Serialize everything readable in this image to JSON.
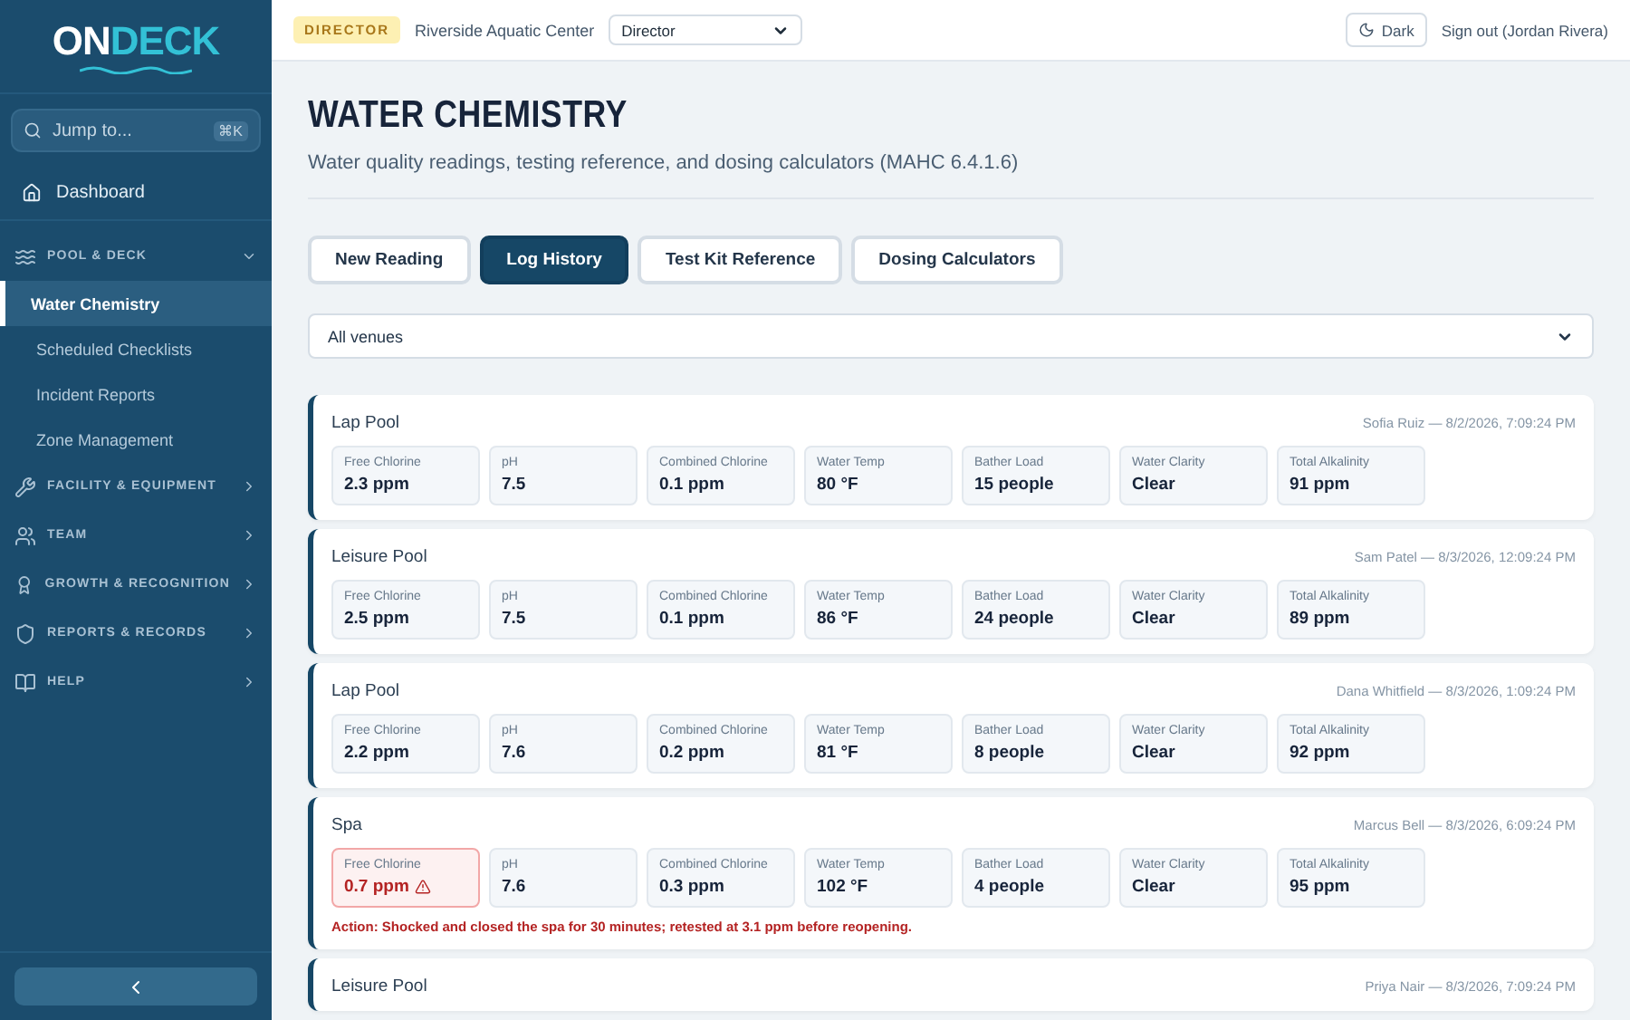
{
  "sidebar": {
    "logo": {
      "part_1": "ON",
      "part_2": "DECK"
    },
    "search": {
      "placeholder": "Jump to...",
      "shortcut": "⌘K"
    },
    "dashboard": {
      "label": "Dashboard",
      "kind": "home"
    },
    "sections": [
      {
        "label": "POOL & DECK",
        "kind": "waves",
        "expanded": true,
        "children": [
          {
            "label": "Water Chemistry",
            "selected": true
          },
          {
            "label": "Scheduled Checklists",
            "selected": false
          },
          {
            "label": "Incident Reports",
            "selected": false
          },
          {
            "label": "Zone Management",
            "selected": false
          }
        ]
      },
      {
        "label": "FACILITY & EQUIPMENT",
        "kind": "wrench",
        "expanded": false
      },
      {
        "label": "TEAM",
        "kind": "team",
        "expanded": false
      },
      {
        "label": "GROWTH & RECOGNITION",
        "kind": "award",
        "expanded": false
      },
      {
        "label": "REPORTS & RECORDS",
        "kind": "shield",
        "expanded": false
      },
      {
        "label": "HELP",
        "kind": "book",
        "expanded": false
      }
    ]
  },
  "topbar": {
    "role_badge": "DIRECTOR",
    "facility": "Riverside Aquatic Center",
    "role_select": "Director",
    "theme_button": "Dark",
    "sign_out": "Sign out (Jordan Rivera)"
  },
  "page": {
    "title": "WATER CHEMISTRY",
    "subtitle": "Water quality readings, testing reference, and dosing calculators (MAHC 6.4.1.6)"
  },
  "tabs": [
    {
      "label": "New Reading",
      "selected": false
    },
    {
      "label": "Log History",
      "selected": true
    },
    {
      "label": "Test Kit Reference",
      "selected": false
    },
    {
      "label": "Dosing Calculators",
      "selected": false
    }
  ],
  "venue_filter": "All venues",
  "readings": [
    {
      "venue": "Lap Pool",
      "meta": "Sofia Ruiz — 8/2/2026, 7:09:24 PM",
      "metrics": [
        {
          "label": "Free Chlorine",
          "value": "2.3 ppm",
          "alert": false
        },
        {
          "label": "pH",
          "value": "7.5",
          "alert": false
        },
        {
          "label": "Combined Chlorine",
          "value": "0.1 ppm",
          "alert": false
        },
        {
          "label": "Water Temp",
          "value": "80 °F",
          "alert": false
        },
        {
          "label": "Bather Load",
          "value": "15 people",
          "alert": false
        },
        {
          "label": "Water Clarity",
          "value": "Clear",
          "alert": false
        },
        {
          "label": "Total Alkalinity",
          "value": "91 ppm",
          "alert": false
        }
      ]
    },
    {
      "venue": "Leisure Pool",
      "meta": "Sam Patel — 8/3/2026, 12:09:24 PM",
      "metrics": [
        {
          "label": "Free Chlorine",
          "value": "2.5 ppm",
          "alert": false
        },
        {
          "label": "pH",
          "value": "7.5",
          "alert": false
        },
        {
          "label": "Combined Chlorine",
          "value": "0.1 ppm",
          "alert": false
        },
        {
          "label": "Water Temp",
          "value": "86 °F",
          "alert": false
        },
        {
          "label": "Bather Load",
          "value": "24 people",
          "alert": false
        },
        {
          "label": "Water Clarity",
          "value": "Clear",
          "alert": false
        },
        {
          "label": "Total Alkalinity",
          "value": "89 ppm",
          "alert": false
        }
      ]
    },
    {
      "venue": "Lap Pool",
      "meta": "Dana Whitfield — 8/3/2026, 1:09:24 PM",
      "metrics": [
        {
          "label": "Free Chlorine",
          "value": "2.2 ppm",
          "alert": false
        },
        {
          "label": "pH",
          "value": "7.6",
          "alert": false
        },
        {
          "label": "Combined Chlorine",
          "value": "0.2 ppm",
          "alert": false
        },
        {
          "label": "Water Temp",
          "value": "81 °F",
          "alert": false
        },
        {
          "label": "Bather Load",
          "value": "8 people",
          "alert": false
        },
        {
          "label": "Water Clarity",
          "value": "Clear",
          "alert": false
        },
        {
          "label": "Total Alkalinity",
          "value": "92 ppm",
          "alert": false
        }
      ]
    },
    {
      "venue": "Spa",
      "meta": "Marcus Bell — 8/3/2026, 6:09:24 PM",
      "action": "Action: Shocked and closed the spa for 30 minutes; retested at 3.1 ppm before reopening.",
      "metrics": [
        {
          "label": "Free Chlorine",
          "value": "0.7 ppm",
          "alert": true
        },
        {
          "label": "pH",
          "value": "7.6",
          "alert": false
        },
        {
          "label": "Combined Chlorine",
          "value": "0.3 ppm",
          "alert": false
        },
        {
          "label": "Water Temp",
          "value": "102 °F",
          "alert": false
        },
        {
          "label": "Bather Load",
          "value": "4 people",
          "alert": false
        },
        {
          "label": "Water Clarity",
          "value": "Clear",
          "alert": false
        },
        {
          "label": "Total Alkalinity",
          "value": "95 ppm",
          "alert": false
        }
      ]
    },
    {
      "venue": "Leisure Pool",
      "meta": "Priya Nair — 8/3/2026, 7:09:24 PM"
    }
  ]
}
